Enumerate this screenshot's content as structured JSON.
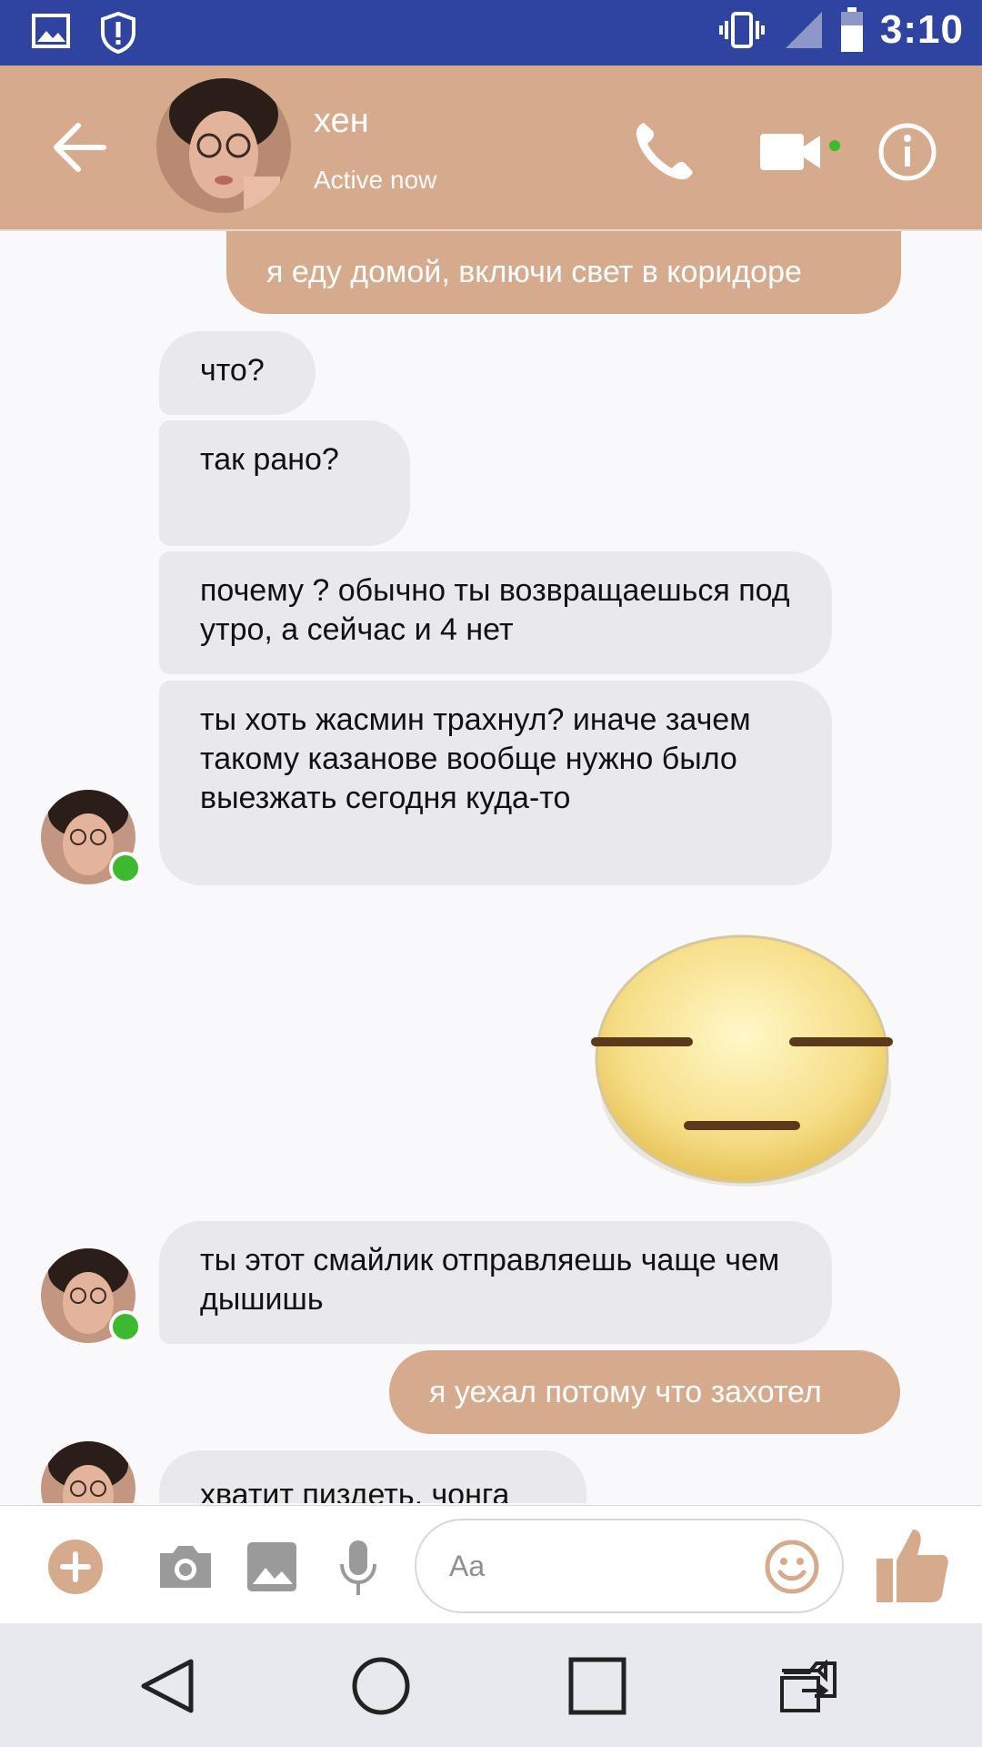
{
  "statusbar": {
    "time": "3:10"
  },
  "header": {
    "name": "хен",
    "status": "Active now"
  },
  "messages": [
    {
      "text": "я еду домой, включи свет в коридоре"
    },
    {
      "text": "что?"
    },
    {
      "text": "так рано?"
    },
    {
      "text": "почему ? обычно ты возвращаешься под утро, а сейчас и 4 нет"
    },
    {
      "text": "ты хоть жасмин трахнул? иначе зачем такому казанове вообще нужно было выезжать сегодня куда-то"
    },
    {
      "text": "ты этот смайлик отправляешь чаще чем дышишь"
    },
    {
      "text": "я уехал потому что захотел"
    },
    {
      "text": "хватит пиздеть, чонга"
    }
  ],
  "composer": {
    "placeholder": "Aa"
  },
  "colors": {
    "accent": "#d6aa8c",
    "statusbar": "#2f43a1",
    "online": "#3cb92f"
  },
  "icons": [
    "back-arrow-icon",
    "phone-icon",
    "video-icon",
    "info-icon",
    "plus-icon",
    "camera-icon",
    "gallery-icon",
    "mic-icon",
    "emoji-icon",
    "thumbs-up-icon",
    "nav-back-icon",
    "nav-home-icon",
    "nav-recents-icon",
    "nav-switch-icon"
  ]
}
